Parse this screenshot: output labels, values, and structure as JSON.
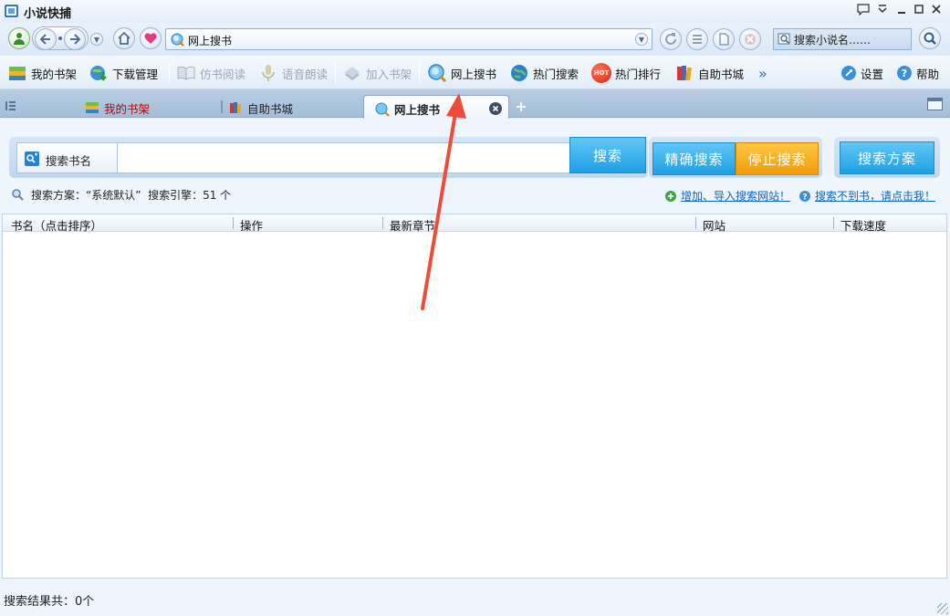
{
  "window": {
    "title": "小说快捕"
  },
  "nav": {
    "address": "网上搜书",
    "search_placeholder": "搜索小说名……"
  },
  "toolbar": {
    "items": [
      {
        "label": "我的书架",
        "icon": "bookshelf-icon",
        "enabled": true
      },
      {
        "label": "下载管理",
        "icon": "download-globe-icon",
        "enabled": true
      },
      {
        "label": "仿书阅读",
        "icon": "open-book-icon",
        "enabled": false
      },
      {
        "label": "语音朗读",
        "icon": "microphone-icon",
        "enabled": false
      },
      {
        "label": "加入书架",
        "icon": "add-book-icon",
        "enabled": false
      },
      {
        "label": "网上搜书",
        "icon": "globe-search-icon",
        "enabled": true
      },
      {
        "label": "热门搜索",
        "icon": "earth-icon",
        "enabled": true
      },
      {
        "label": "热门排行",
        "icon": "hot-badge-icon",
        "enabled": true
      },
      {
        "label": "自助书城",
        "icon": "books-icon",
        "enabled": true
      }
    ],
    "more": "»",
    "settings_label": "设置",
    "help_label": "帮助",
    "hot_badge_text": "HOT"
  },
  "tabs": [
    {
      "label": "我的书架",
      "active": false
    },
    {
      "label": "自助书城",
      "active": false
    },
    {
      "label": "网上搜书",
      "active": true
    }
  ],
  "search": {
    "field_label": "搜索书名",
    "value": "",
    "search_button": "搜索",
    "exact_button": "精确搜索",
    "stop_button": "停止搜索",
    "scheme_button": "搜索方案",
    "scheme_info": "搜索方案：“系统默认”  搜索引擎：51 个",
    "add_site_link": "增加、导入搜索网站！",
    "not_found_link": "搜索不到书，请点击我！"
  },
  "table": {
    "columns": [
      "书名（点击排序）",
      "操作",
      "最新章节",
      "网站",
      "下载速度"
    ],
    "rows": []
  },
  "status": {
    "text": "搜索结果共：0个"
  },
  "colors": {
    "accent_blue": "#1f9fe3",
    "accent_orange": "#f09c0a",
    "active_tab_text": "#c00000",
    "annotation_arrow": "#ef4b36"
  }
}
